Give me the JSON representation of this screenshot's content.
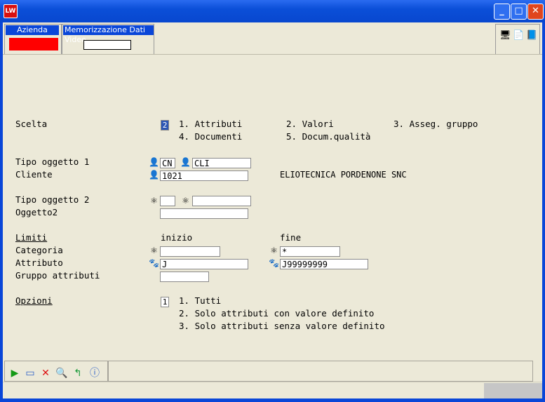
{
  "window": {
    "title": "",
    "app_icon": "LW",
    "minimize_icon": "minimize-icon",
    "maximize_icon": "maximize-icon",
    "close_icon": "close-icon"
  },
  "header": {
    "azienda_label": "Azienda",
    "azienda_color": "#ff0000",
    "memo_label": "Memorizzazione Dati Video",
    "memo_value": "",
    "toolbar_icons": [
      "display-icon",
      "notes-icon",
      "book-icon"
    ]
  },
  "form": {
    "scelta_label": "Scelta",
    "scelta_value": "2",
    "scelta_options": [
      "1. Attributi",
      "2. Valori",
      "3. Asseg. gruppo",
      "4. Documenti",
      "5. Docum.qualità"
    ],
    "tipo1_label": "Tipo oggetto 1",
    "tipo1_a": "CN",
    "tipo1_b": "CLI",
    "cliente_label": "Cliente",
    "cliente_value": "1021",
    "cliente_desc": "ELIOTECNICA PORDENONE SNC",
    "tipo2_label": "Tipo oggetto 2",
    "tipo2_a": "",
    "tipo2_b": "",
    "oggetto2_label": "Oggetto2",
    "oggetto2_value": "",
    "limiti_label": "Limiti",
    "inizio_label": "inizio",
    "fine_label": "fine",
    "categoria_label": "Categoria",
    "categoria_inizio": "",
    "categoria_fine": "*",
    "attributo_label": "Attributo",
    "attributo_inizio": "J",
    "attributo_fine": "J99999999",
    "gruppo_label": "Gruppo attributi",
    "gruppo_value": "",
    "opzioni_label": "Opzioni",
    "opzioni_value": "1",
    "opzioni_options": [
      "1. Tutti",
      "2. Solo attributi con valore definito",
      "3. Solo attributi senza valore definito"
    ]
  },
  "footer": {
    "buttons": [
      "run-icon",
      "open-icon",
      "cancel-icon",
      "search-icon",
      "back-icon",
      "info-icon"
    ]
  }
}
